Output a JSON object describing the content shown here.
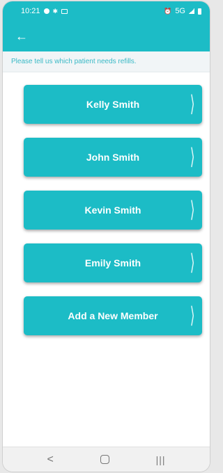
{
  "status_bar": {
    "time": "10:21",
    "network": "5G",
    "icons_left": [
      "messenger-icon",
      "gear-icon",
      "image-icon"
    ],
    "icons_right": [
      "alarm-icon",
      "signal-icon",
      "battery-icon"
    ]
  },
  "app_bar": {
    "back_icon": "arrow-left-icon"
  },
  "prompt": "Please tell us which patient needs refills.",
  "members": [
    {
      "label": "Kelly Smith"
    },
    {
      "label": "John Smith"
    },
    {
      "label": "Kevin Smith"
    },
    {
      "label": "Emily Smith"
    },
    {
      "label": "Add a New Member"
    }
  ],
  "colors": {
    "accent": "#1cbcc6",
    "prompt_text": "#39b9c6",
    "prompt_bg": "#f1f5f7"
  },
  "nav_bar": {
    "icons": [
      "back-icon",
      "home-icon",
      "recents-icon"
    ]
  }
}
